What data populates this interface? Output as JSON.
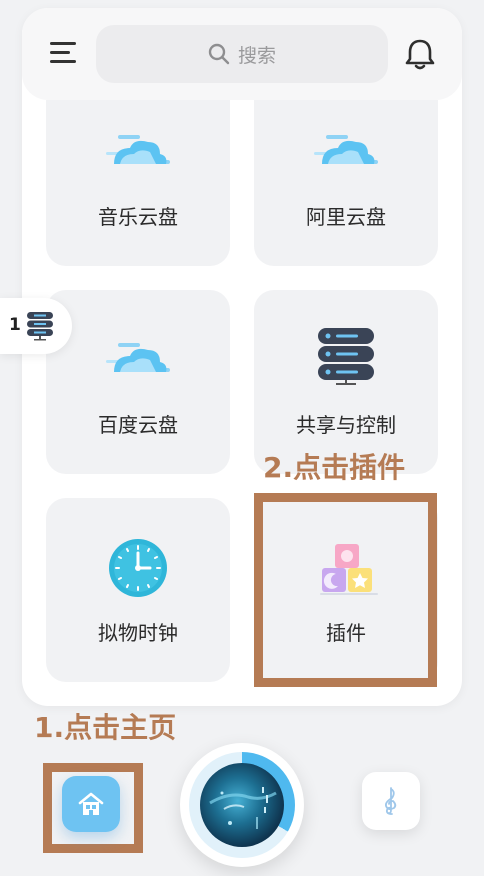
{
  "header": {
    "search_placeholder": "搜索",
    "menu_icon": "hamburger-menu-icon",
    "bell_icon": "bell-icon"
  },
  "cards": [
    {
      "label": "音乐云盘",
      "icon": "cloud-transfer-icon"
    },
    {
      "label": "阿里云盘",
      "icon": "cloud-transfer-icon"
    },
    {
      "label": "百度云盘",
      "icon": "cloud-transfer-icon"
    },
    {
      "label": "共享与控制",
      "icon": "server-stack-icon"
    },
    {
      "label": "拟物时钟",
      "icon": "clock-icon"
    },
    {
      "label": "插件",
      "icon": "toy-blocks-icon"
    }
  ],
  "side_tab": {
    "number": "1",
    "icon": "server-icon"
  },
  "annotations": {
    "step1": "1.点击主页",
    "step2": "2.点击插件"
  },
  "bottom_nav": {
    "home_icon": "home-icon",
    "player_icon": "album-cover",
    "music_icon": "treble-clef-icon"
  },
  "colors": {
    "accent_blue": "#4fb9ef",
    "annotation_brown": "#b57b54",
    "card_bg": "#f1f2f4"
  }
}
